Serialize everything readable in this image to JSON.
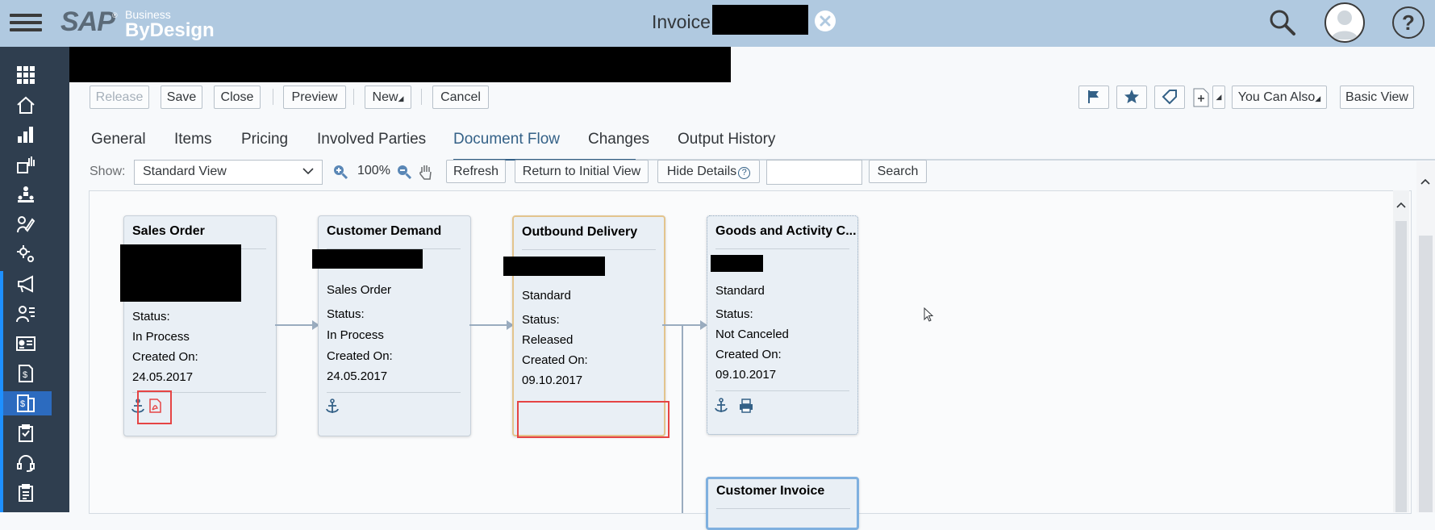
{
  "header": {
    "brand_sap": "SAP",
    "brand_business": "Business",
    "brand_bydesign": "ByDesign",
    "title_prefix": "Invoice:",
    "icons": [
      "menu-icon",
      "search-icon",
      "user-avatar-icon",
      "help-icon",
      "close-icon"
    ]
  },
  "sidebar": {
    "icons": [
      "apps-grid-icon",
      "home-icon",
      "chart-icon",
      "analytics-icon",
      "org-icon",
      "edit-icon",
      "settings-icon",
      "megaphone-icon",
      "people-icon",
      "contact-card-icon",
      "invoice-icon",
      "invoice-active-icon",
      "clipboard-icon",
      "headset-icon",
      "checklist-icon"
    ],
    "selected_index": 11
  },
  "toolbar": {
    "release_label": "Release",
    "save_label": "Save",
    "close_label": "Close",
    "preview_label": "Preview",
    "new_label": "New",
    "cancel_label": "Cancel",
    "you_can_also_label": "You Can Also",
    "basic_view_label": "Basic View",
    "right_icons": [
      "flag-icon",
      "star-icon",
      "tag-icon",
      "new-document-icon"
    ]
  },
  "tabs": [
    {
      "label": "General",
      "active": false
    },
    {
      "label": "Items",
      "active": false
    },
    {
      "label": "Pricing",
      "active": false
    },
    {
      "label": "Involved Parties",
      "active": false
    },
    {
      "label": "Document Flow",
      "active": true
    },
    {
      "label": "Changes",
      "active": false
    },
    {
      "label": "Output History",
      "active": false
    }
  ],
  "flow_toolbar": {
    "show_label": "Show:",
    "view_value": "Standard View",
    "zoom_value": "100%",
    "refresh_label": "Refresh",
    "return_label": "Return to Initial View",
    "hide_details_label": "Hide Details",
    "search_label": "Search",
    "search_value": ""
  },
  "cards": [
    {
      "title": "Sales Order",
      "type": "",
      "status_label": "Status:",
      "status": "In Process",
      "created_label": "Created On:",
      "created": "24.05.2017"
    },
    {
      "title": "Customer Demand",
      "type": "Sales Order",
      "status_label": "Status:",
      "status": "In Process",
      "created_label": "Created On:",
      "created": "24.05.2017"
    },
    {
      "title": "Outbound Delivery",
      "type": "Standard",
      "status_label": "Status:",
      "status": "Released",
      "created_label": "Created On:",
      "created": "09.10.2017"
    },
    {
      "title": "Goods and Activity C...",
      "type": "Standard",
      "status_label": "Status:",
      "status": "Not Canceled",
      "created_label": "Created On:",
      "created": "09.10.2017"
    },
    {
      "title": "Customer Invoice"
    }
  ],
  "colors": {
    "header_bg": "#b0c9e0",
    "sidebar_bg": "#2f3e4f",
    "active_tab": "#346187",
    "highlight_border": "#e54444"
  }
}
